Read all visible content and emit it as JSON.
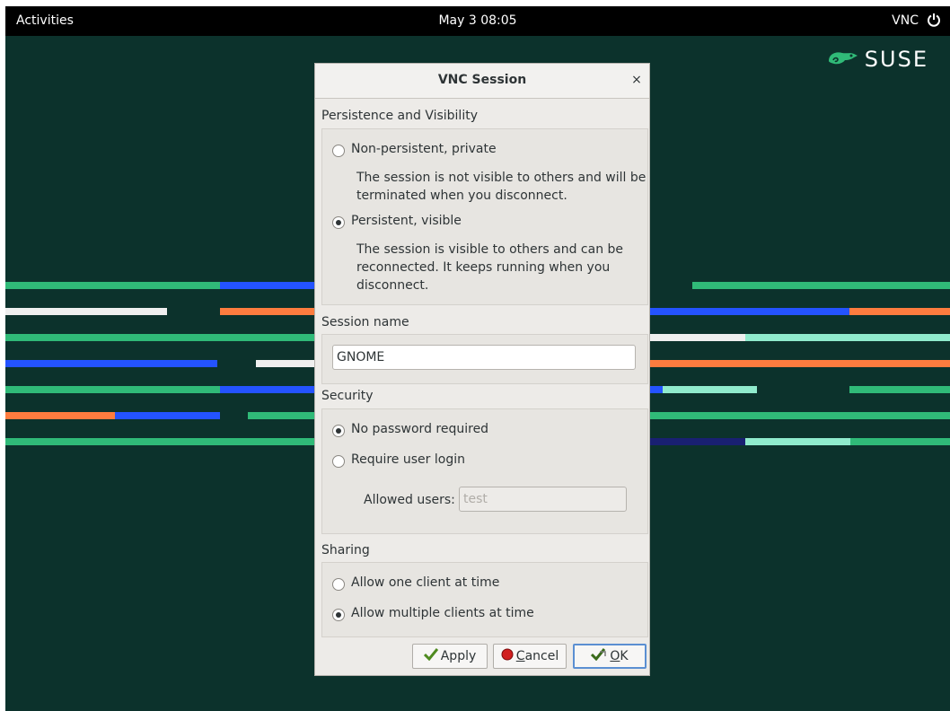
{
  "topbar": {
    "activities": "Activities",
    "clock": "May 3  08:05",
    "vnc": "VNC",
    "power_icon": "power-icon"
  },
  "desktop": {
    "logo_text": "SUSE",
    "logo_icon": "suse-chameleon-icon"
  },
  "dialog": {
    "title": "VNC Session",
    "close_label": "×",
    "persistence": {
      "label": "Persistence and Visibility",
      "option1": "Non-persistent, private",
      "option1_desc": [
        "The session is not visible to others and will be",
        "terminated when you disconnect."
      ],
      "option2": "Persistent, visible",
      "option2_desc": [
        "The session is visible to others and can be",
        "reconnected. It keeps running when you",
        "disconnect."
      ],
      "selected": "option2"
    },
    "session_name": {
      "label": "Session name",
      "value": "GNOME"
    },
    "security": {
      "label": "Security",
      "option1": "No password required",
      "option2": "Require user login",
      "allowed_users_label": "Allowed users:",
      "allowed_users_value": "test",
      "selected": "option1"
    },
    "sharing": {
      "label": "Sharing",
      "option1": "Allow one client at time",
      "option2": "Allow multiple clients at time",
      "selected": "option2"
    },
    "buttons": {
      "apply": "Apply",
      "cancel_mnemonic": "C",
      "cancel_rest": "ancel",
      "ok_mnemonic": "O",
      "ok_rest": "K"
    }
  },
  "colors": {
    "background": "#0c322c",
    "green": "#30ba78",
    "blue": "#2453ff",
    "orange": "#fe7c3f",
    "white": "#efefef",
    "mint": "#90ebcd",
    "navy": "#192072"
  }
}
